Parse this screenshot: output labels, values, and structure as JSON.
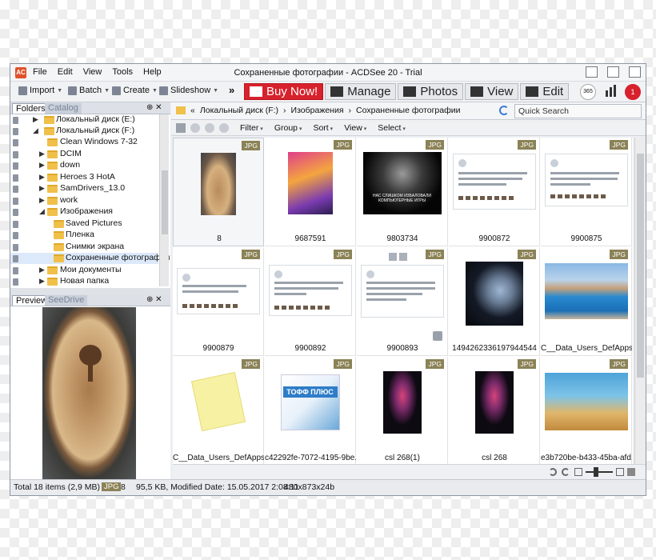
{
  "window": {
    "title": "Сохраненные фотографии - ACDSee 20 - Trial",
    "app_icon": "acdsee-app-icon"
  },
  "menu": [
    "File",
    "Edit",
    "View",
    "Tools",
    "Help"
  ],
  "toolbar": {
    "import": "Import",
    "batch": "Batch",
    "create": "Create",
    "slideshow": "Slideshow",
    "more": "»"
  },
  "modes": {
    "buy": "Buy Now!",
    "manage": "Manage",
    "photos": "Photos",
    "view": "View",
    "edit": "Edit",
    "badge_365": "365",
    "notify_count": "1"
  },
  "folders_panel": {
    "tabs": [
      "Folders",
      "Catalog"
    ],
    "pin": "⊕ ✕",
    "items": [
      {
        "label": "Локальный диск (E:)",
        "arrow": "▶"
      },
      {
        "label": "Локальный диск (F:)",
        "arrow": "◢"
      },
      {
        "label": "Clean Windows 7-32",
        "arrow": ""
      },
      {
        "label": "DCIM",
        "arrow": "▶"
      },
      {
        "label": "down",
        "arrow": "▶"
      },
      {
        "label": "Heroes 3 HotA",
        "arrow": "▶"
      },
      {
        "label": "SamDrivers_13.0",
        "arrow": "▶"
      },
      {
        "label": "work",
        "arrow": "▶"
      },
      {
        "label": "Изображения",
        "arrow": "◢"
      },
      {
        "label": "Saved Pictures",
        "arrow": ""
      },
      {
        "label": "Пленка",
        "arrow": ""
      },
      {
        "label": "Снимки экрана",
        "arrow": ""
      },
      {
        "label": "Сохраненные фотографии",
        "arrow": ""
      },
      {
        "label": "Мои документы",
        "arrow": "▶"
      },
      {
        "label": "Новая папка",
        "arrow": "▶"
      }
    ]
  },
  "preview_panel": {
    "tabs": [
      "Preview",
      "SeeDrive"
    ],
    "pin": "⊕ ✕"
  },
  "address": {
    "back": "«",
    "crumbs": [
      "Локальный диск (F:)",
      "Изображения",
      "Сохраненные фотографии"
    ],
    "separator": "›",
    "search_placeholder": "Quick Search"
  },
  "nav": {
    "menu": [
      "Filter",
      "Group",
      "Sort",
      "View",
      "Select"
    ]
  },
  "files": [
    {
      "name": "8",
      "type": "JPG",
      "kind": "wood"
    },
    {
      "name": "9687591",
      "type": "JPG",
      "kind": "poster"
    },
    {
      "name": "9803734",
      "type": "JPG",
      "kind": "dark",
      "text": "НАС СЛИШКОМ ИЗБАЛОВАЛИ КОМПЬЮТЕРНЫЕ ИГРЫ"
    },
    {
      "name": "9900872",
      "type": "JPG",
      "kind": "tweet"
    },
    {
      "name": "9900875",
      "type": "JPG",
      "kind": "tweet"
    },
    {
      "name": "9900879",
      "type": "JPG",
      "kind": "tweet"
    },
    {
      "name": "9900892",
      "type": "JPG",
      "kind": "tweet"
    },
    {
      "name": "9900893",
      "type": "JPG",
      "kind": "tweet"
    },
    {
      "name": "1494262336197944544",
      "type": "JPG",
      "kind": "window"
    },
    {
      "name": "C__Data_Users_DefApps_...",
      "type": "JPG",
      "kind": "pool"
    },
    {
      "name": "C__Data_Users_DefApps_...",
      "type": "JPG",
      "kind": "note"
    },
    {
      "name": "c42292fe-7072-4195-9be...",
      "type": "JPG",
      "kind": "box",
      "text": "ТОФФ ПЛЮС"
    },
    {
      "name": "csl 268(1)",
      "type": "JPG",
      "kind": "owl"
    },
    {
      "name": "csl 268",
      "type": "JPG",
      "kind": "owl"
    },
    {
      "name": "e3b720be-b433-45ba-afd...",
      "type": "JPG",
      "kind": "cartoon"
    }
  ],
  "status": {
    "total": "Total 18 items  (2,9 MB)",
    "type_badge": "JPG",
    "type_count": "8",
    "info": "95,5 KB, Modified Date: 15.05.2017 2:08:11",
    "dims": "480x873x24b"
  },
  "colors": {
    "buy_red": "#d7212c",
    "badge": "#8b8256",
    "selection": "#dce9fb"
  }
}
